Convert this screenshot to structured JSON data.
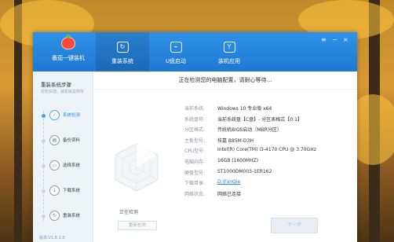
{
  "app": {
    "brand_name": "番茄一键装机",
    "tabs": [
      {
        "label": "重装系统",
        "icon": "os-reinstall-icon",
        "active": true
      },
      {
        "label": "U盘启动",
        "icon": "usb-icon",
        "active": false
      },
      {
        "label": "装机应用",
        "icon": "apps-icon",
        "active": false
      }
    ],
    "window_controls": {
      "menu": "≡",
      "minimize": "−",
      "close": "×"
    }
  },
  "sidebar": {
    "title": "重装系统步骤",
    "subtitle": "轻松快捷，装机就是简单",
    "steps": [
      {
        "label": "系统检测",
        "icon": "detect-icon",
        "active": true
      },
      {
        "label": "备份资料",
        "icon": "backup-icon",
        "active": false
      },
      {
        "label": "选择系统",
        "icon": "choose-system-icon",
        "active": false
      },
      {
        "label": "下载系统",
        "icon": "download-icon",
        "active": false
      },
      {
        "label": "重装系统",
        "icon": "reinstall-icon",
        "active": false
      }
    ],
    "version": "版本:V1.6.1.0"
  },
  "main": {
    "heading": "正在检测您的电脑配置，请耐心等待…",
    "radar_caption": "正在检测",
    "radar_button": "重新检测",
    "info": [
      {
        "key": "当前系统:",
        "value": "Windows 10 专业版 x64",
        "link": false
      },
      {
        "key": "系统盘符:",
        "value": "当前系统盘【C盘】- 分区表格式【0:1】",
        "link": false
      },
      {
        "key": "分区格式:",
        "value": "传统机BIOS启动（MBR分区）",
        "link": false
      },
      {
        "key": "主板型号:",
        "value": "技嘉 B85M-D3H",
        "link": false
      },
      {
        "key": "CPU型号:",
        "value": "Intel(R) Core(TM) i3-4170 CPU @ 3.70GHz",
        "link": false
      },
      {
        "key": "电脑内存:",
        "value": "16GB (1600MHZ)",
        "link": false
      },
      {
        "key": "硬盘型号:",
        "value": "ST1000DM003-1ER162",
        "link": false
      },
      {
        "key": "下载目录:",
        "value": "D:\\FanQie",
        "link": true
      },
      {
        "key": "网络状态:",
        "value": "网络已连接",
        "link": false
      }
    ],
    "next_button": "下一步"
  },
  "colors": {
    "accent": "#2486e0",
    "topbar": "#1f78d2",
    "sidebar_bg": "#eef3f8"
  }
}
